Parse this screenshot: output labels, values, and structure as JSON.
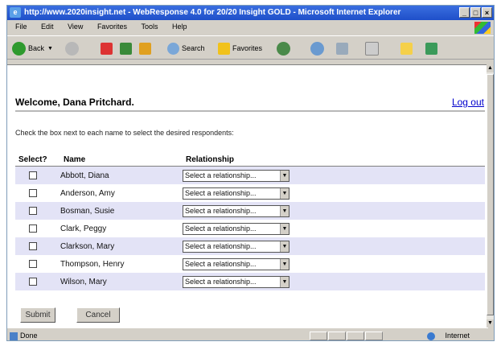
{
  "window": {
    "title": "http://www.2020insight.net - WebResponse 4.0 for 20/20 Insight GOLD - Microsoft Internet Explorer",
    "controls": [
      "_",
      "□",
      "×"
    ]
  },
  "menu": [
    "File",
    "Edit",
    "View",
    "Favorites",
    "Tools",
    "Help"
  ],
  "toolbar": {
    "back": "Back",
    "search": "Search",
    "favorites": "Favorites"
  },
  "page": {
    "welcome": "Welcome, Dana Pritchard.",
    "logout": "Log out",
    "instruction": "Check the box next to each name to select the desired respondents:",
    "columns": [
      "Select?",
      "Name",
      "Relationship"
    ],
    "rows": [
      {
        "name": "Abbott, Diana",
        "relationship": "Select a relationship..."
      },
      {
        "name": "Anderson, Amy",
        "relationship": "Select a relationship..."
      },
      {
        "name": "Bosman, Susie",
        "relationship": "Select a relationship..."
      },
      {
        "name": "Clark, Peggy",
        "relationship": "Select a relationship..."
      },
      {
        "name": "Clarkson, Mary",
        "relationship": "Select a relationship..."
      },
      {
        "name": "Thompson, Henry",
        "relationship": "Select a relationship..."
      },
      {
        "name": "Wilson, Mary",
        "relationship": "Select a relationship..."
      }
    ],
    "submit": "Submit",
    "cancel": "Cancel"
  },
  "status": {
    "text": "Done",
    "zone": "Internet"
  }
}
